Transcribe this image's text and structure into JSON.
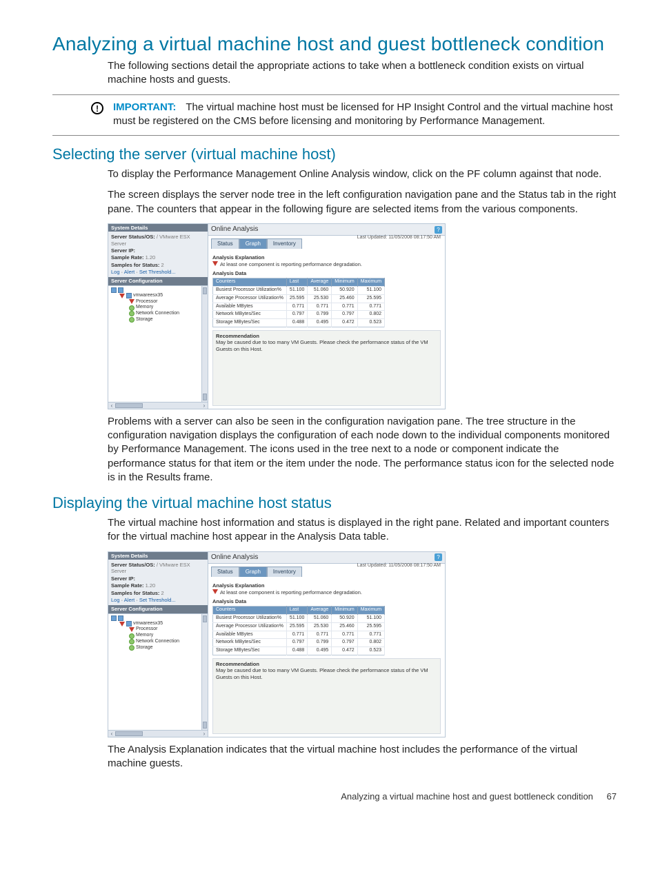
{
  "h1": "Analyzing a virtual machine host and guest bottleneck condition",
  "intro": "The following sections detail the appropriate actions to take when a bottleneck condition exists on virtual machine hosts and guests.",
  "important": {
    "label": "IMPORTANT:",
    "text": "The virtual machine host must be licensed for HP Insight Control and the virtual machine host must be registered on the CMS before licensing and monitoring by Performance Management."
  },
  "sec1": {
    "h": "Selecting the server (virtual machine host)",
    "p1": "To display the Performance Management Online Analysis window, click on the PF column against that node.",
    "p2": "The screen displays the server node tree in the left configuration navigation pane and the Status tab in the right pane. The counters that appear in the following figure are selected items from the various components.",
    "p3": "Problems with a server can also be seen in the configuration navigation pane. The tree structure in the configuration navigation displays the configuration of each node down to the individual components monitored by Performance Management. The icons used in the tree next to a node or component indicate the performance status for that item or the item under the node. The performance status icon for the selected node is in the Results frame."
  },
  "sec2": {
    "h": "Displaying the virtual machine host status",
    "p1": "The virtual machine host information and status is displayed in the right pane. Related and important counters for the virtual machine host appear in the Analysis Data table.",
    "p2": "The Analysis Explanation indicates that the virtual machine host includes the performance of the virtual machine guests."
  },
  "shot": {
    "sys_details": "System Details",
    "server_status_lbl": "Server Status/OS:",
    "server_status_val": "/ VMware ESX Server",
    "server_ip_lbl": "Server IP:",
    "sample_rate_lbl": "Sample Rate:",
    "sample_rate_val": "1.20",
    "samples_lbl": "Samples for Status:",
    "samples_val": "2",
    "log": "Log",
    "alert": "Alert",
    "set_thresh": "Set Threshold...",
    "server_conf": "Server Configuration",
    "root": "vmwareesx35",
    "nodes": [
      "Processor",
      "Memory",
      "Network Connection",
      "Storage"
    ],
    "oa_title": "Online Analysis",
    "last_updated": "Last Updated: 11/05/2008 08:17:50 AM",
    "tabs": [
      "Status",
      "Graph",
      "Inventory"
    ],
    "analysis_expl_h": "Analysis Explanation",
    "analysis_expl_t": "At least one component is reporting performance degradation.",
    "analysis_data_h": "Analysis Data",
    "cols": [
      "Counters",
      "Last",
      "Average",
      "Minimum",
      "Maximum"
    ],
    "rows": [
      [
        "Busiest Processor Utilization%",
        "51.100",
        "51.060",
        "50.920",
        "51.100"
      ],
      [
        "Average Processor Utilization%",
        "25.595",
        "25.530",
        "25.460",
        "25.595"
      ],
      [
        "Available MBytes",
        "0.771",
        "0.771",
        "0.771",
        "0.771"
      ],
      [
        "Network MBytes/Sec",
        "0.797",
        "0.799",
        "0.797",
        "0.802"
      ],
      [
        "Storage MBytes/Sec",
        "0.488",
        "0.495",
        "0.472",
        "0.523"
      ]
    ],
    "rec_h": "Recommendation",
    "rec_t": "May be caused due to too many VM Guests. Please check the performance status of the VM Guests on this Host."
  },
  "footer": {
    "text": "Analyzing a virtual machine host and guest bottleneck condition",
    "page": "67"
  }
}
